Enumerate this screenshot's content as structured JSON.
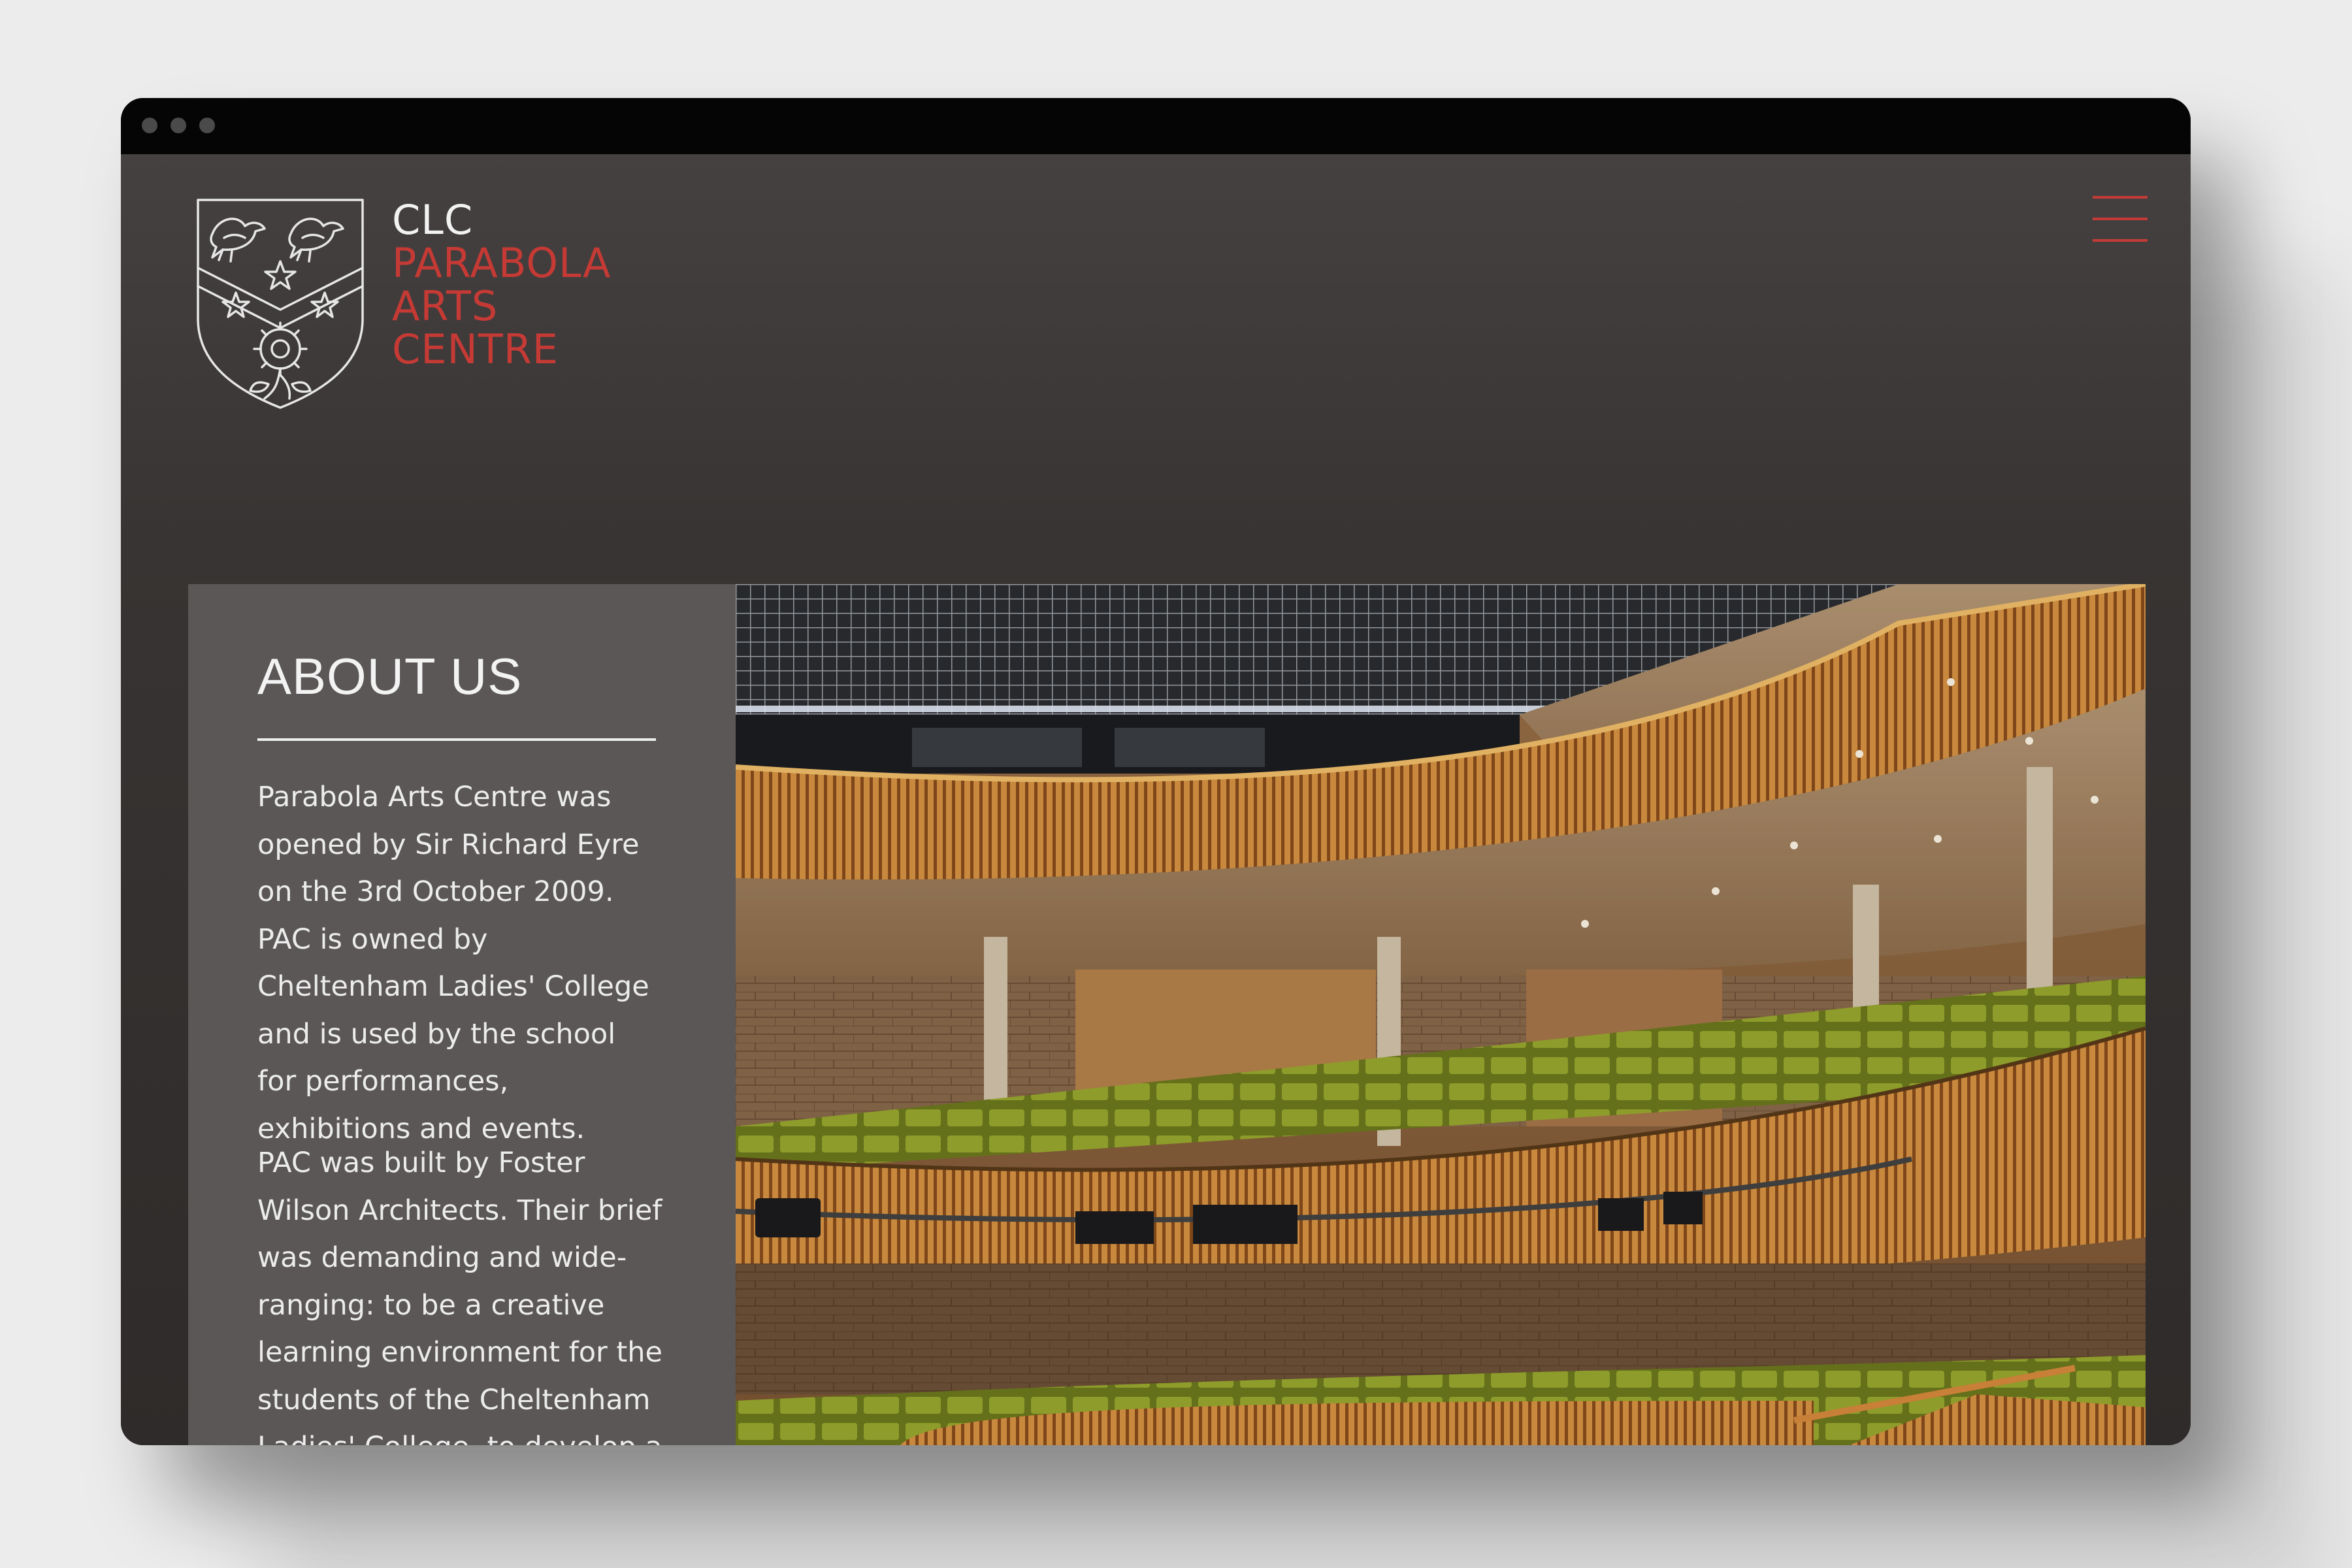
{
  "window": {
    "dots": [
      "",
      "",
      ""
    ]
  },
  "logo": {
    "line1": "CLC",
    "line2": "PARABOLA",
    "line3": "ARTS",
    "line4": "CENTRE",
    "colors": {
      "white": "#f2f2f2",
      "accent": "#c63a35"
    }
  },
  "menu": {
    "icon": "hamburger-menu-icon",
    "color": "#c63a35"
  },
  "about": {
    "title": "ABOUT US",
    "paragraph1": "Parabola Arts Centre was opened by Sir Richard Eyre on the 3rd October 2009. PAC is owned by Cheltenham Ladies' College and is used by the school for performances, exhibitions and events.",
    "paragraph2": "PAC was built by Foster Wilson Architects. Their brief was demanding and wide-ranging: to be a creative learning environment for the students of the Cheltenham Ladies' College, to develop a cutting edge arts space, to offer space for hire to the"
  },
  "photo": {
    "subject": "auditorium-interior-photo"
  }
}
